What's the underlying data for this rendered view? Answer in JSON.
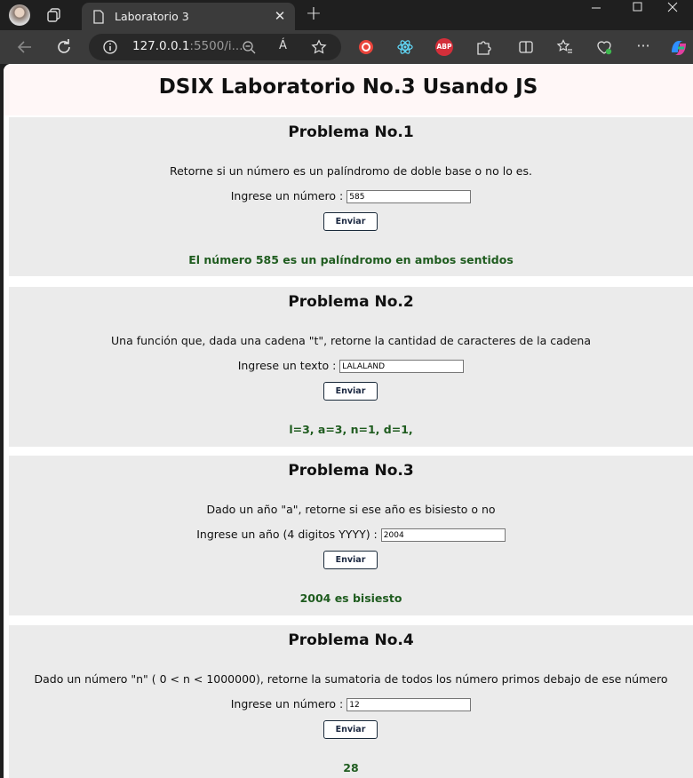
{
  "browser": {
    "tab_title": "Laboratorio 3",
    "url_host": "127.0.0.1",
    "url_rest": ":5500/i...",
    "read_aloud": "Á"
  },
  "page": {
    "title": "DSIX Laboratorio No.3 Usando JS"
  },
  "problems": [
    {
      "heading": "Problema No.1",
      "description": "Retorne si un número es un palíndromo de doble base o no lo es.",
      "label": "Ingrese un número :",
      "value": "585",
      "button": "Enviar",
      "result": "El número 585 es un palíndromo en ambos sentidos"
    },
    {
      "heading": "Problema No.2",
      "description": "Una función que, dada una cadena \"t\", retorne la cantidad de caracteres de la cadena",
      "label": "Ingrese un texto :",
      "value": "LALALAND",
      "button": "Enviar",
      "result": "l=3, a=3, n=1, d=1,"
    },
    {
      "heading": "Problema No.3",
      "description": "Dado un año \"a\", retorne si ese año es bisiesto o no",
      "label": "Ingrese un año (4 digitos YYYY) :",
      "value": "2004",
      "button": "Enviar",
      "result": "2004 es bisiesto"
    },
    {
      "heading": "Problema No.4",
      "description": "Dado un número \"n\" ( 0 < n < 1000000), retorne la sumatoria de todos los número primos debajo de ese número",
      "label": "Ingrese un número :",
      "value": "12",
      "button": "Enviar",
      "result": "28"
    }
  ]
}
